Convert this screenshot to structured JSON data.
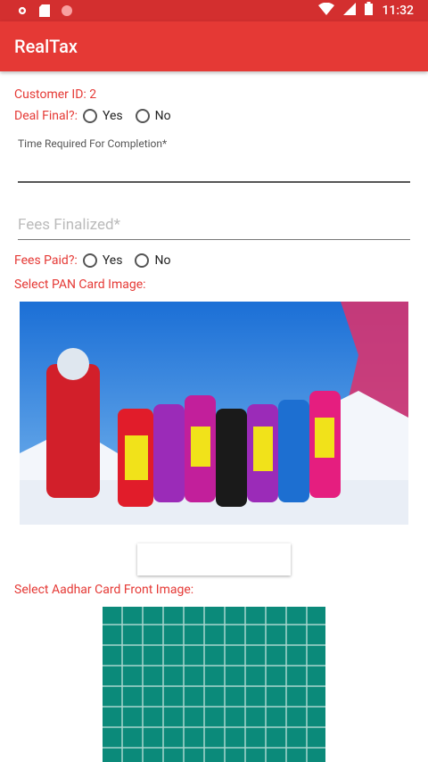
{
  "status_bar": {
    "time": "11:32"
  },
  "app_bar": {
    "title": "RealTax"
  },
  "form": {
    "customer_id": "Customer ID: 2",
    "deal_final_label": "Deal Final?:",
    "fees_paid_label": "Fees Paid?:",
    "yes": "Yes",
    "no": "No",
    "time_required_label": "Time Required For Completion*",
    "fees_finalized_placeholder": "Fees Finalized*",
    "select_pan_label": "Select PAN Card Image:",
    "select_aadhar_front_label": "Select Aadhar Card Front Image:"
  }
}
